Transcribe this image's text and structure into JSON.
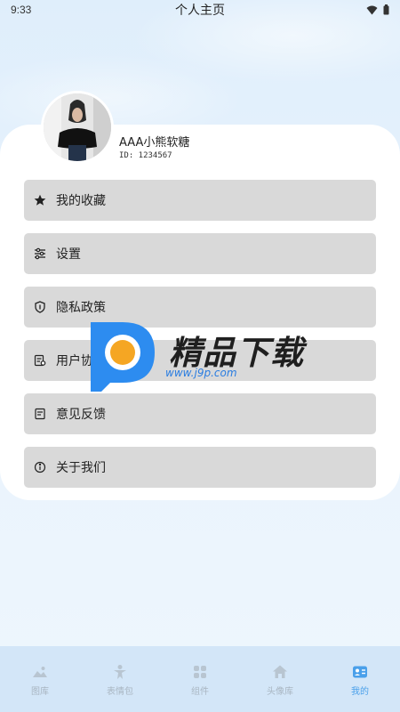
{
  "status_bar": {
    "time": "9:33",
    "title": "个人主页"
  },
  "profile": {
    "name": "AAA小熊软糖",
    "id": "ID: 1234567"
  },
  "menu": [
    {
      "label": "我的收藏",
      "icon": "star-icon"
    },
    {
      "label": "设置",
      "icon": "sliders-icon"
    },
    {
      "label": "隐私政策",
      "icon": "shield-icon"
    },
    {
      "label": "用户协",
      "icon": "document-icon"
    },
    {
      "label": "意见反馈",
      "icon": "feedback-icon"
    },
    {
      "label": "关于我们",
      "icon": "info-icon"
    }
  ],
  "watermark": {
    "text": "精品下载",
    "url": "www.j9p.com"
  },
  "tabbar": [
    {
      "label": "图库",
      "icon": "image-icon",
      "active": false
    },
    {
      "label": "表情包",
      "icon": "person-icon",
      "active": false
    },
    {
      "label": "组件",
      "icon": "grid-icon",
      "active": false
    },
    {
      "label": "头像库",
      "icon": "home-icon",
      "active": false
    },
    {
      "label": "我的",
      "icon": "profile-card-icon",
      "active": true
    }
  ],
  "colors": {
    "accent": "#4aa0ea",
    "tab_inactive": "#a9b6c2",
    "menu_bg": "#d9d9d9",
    "tabbar_bg": "#d3e6f8"
  }
}
